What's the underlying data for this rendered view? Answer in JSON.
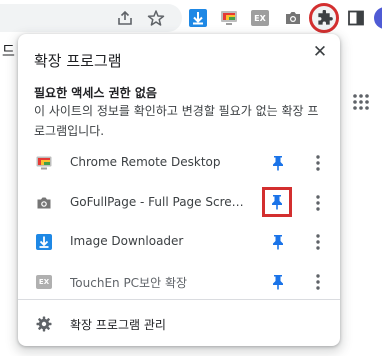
{
  "toolbar": {
    "icons": [
      "share-icon",
      "star-icon",
      "image-downloader-icon",
      "chrome-remote-desktop-icon",
      "touchen-ex-icon",
      "gofullpage-camera-icon",
      "extensions-puzzle-icon",
      "side-panel-icon",
      "profile-avatar"
    ],
    "ex_badge": "EX",
    "highlight_color": "#d32f2f"
  },
  "page": {
    "left_char": "드"
  },
  "popup": {
    "title": "확장 프로그램",
    "close_label": "✕",
    "section_heading": "필요한 액세스 권한 없음",
    "section_desc": "이 사이트의 정보를 확인하고 변경할 필요가 없는 확장 프로그램입니다.",
    "extensions": [
      {
        "name": "Chrome Remote Desktop",
        "icon": "chrome-remote-desktop-icon",
        "pinned": true,
        "highlighted": false
      },
      {
        "name": "GoFullPage - Full Page Screen Capture",
        "icon": "camera-icon",
        "pinned": true,
        "highlighted": true
      },
      {
        "name": "Image Downloader",
        "icon": "download-arrow-icon",
        "pinned": true,
        "highlighted": false
      },
      {
        "name": "TouchEn PC보안 확장",
        "icon": "touchen-ex-icon",
        "icon_text": "EX",
        "pinned": true,
        "highlighted": false
      }
    ],
    "manage_label": "확장 프로그램 관리",
    "pin_color": "#1a73e8"
  }
}
